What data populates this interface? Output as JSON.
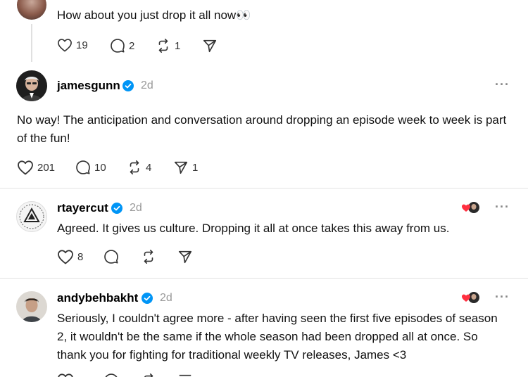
{
  "posts": [
    {
      "username": "",
      "text": "How about you just drop it all now👀",
      "counts": {
        "likes": "19",
        "replies": "2",
        "reposts": "1"
      }
    },
    {
      "username": "jamesgunn",
      "time": "2d",
      "text": "No way! The anticipation and conversation around dropping an episode week to week is part of the fun!",
      "counts": {
        "likes": "201",
        "replies": "10",
        "reposts": "4",
        "shares": "1"
      }
    },
    {
      "username": "rtayercut",
      "time": "2d",
      "text": "Agreed. It gives us culture. Dropping it all at once takes this away from us.",
      "counts": {
        "likes": "8"
      }
    },
    {
      "username": "andybehbakht",
      "time": "2d",
      "text": "Seriously, I couldn't agree more - after having seen the first five episodes of season 2, it wouldn't be the same if the whole season had been dropped all at once. So thank you for fighting for traditional weekly TV releases, James <3"
    }
  ],
  "more_label": "···",
  "colors": {
    "verified": "#0095f6",
    "heart_badge": "#ff3040",
    "divider": "#e2e2e2"
  }
}
